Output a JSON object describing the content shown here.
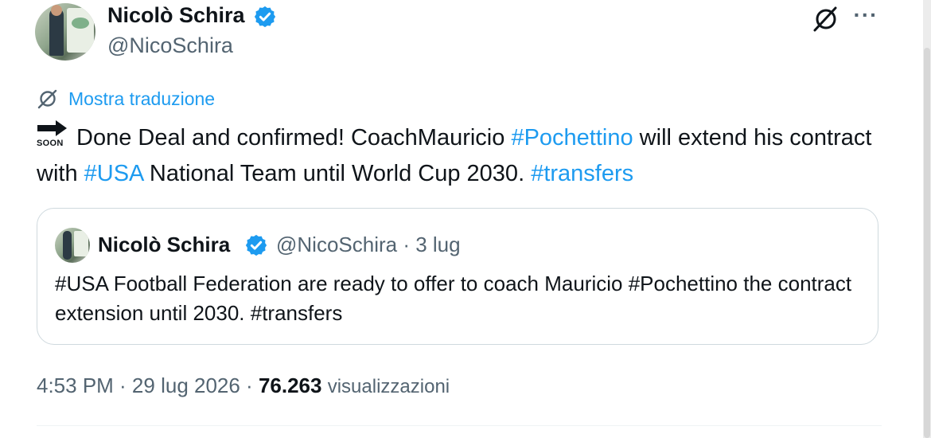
{
  "author": {
    "name": "Nicolò Schira",
    "handle": "@NicoSchira"
  },
  "translate": {
    "label": "Mostra traduzione"
  },
  "tweet": {
    "emoji": "soon-arrow-icon",
    "emoji_label": "SOON",
    "segments": [
      {
        "text": "Done Deal and confirmed! CoachMauricio ",
        "type": "text"
      },
      {
        "text": "#Pochettino",
        "type": "hashtag"
      },
      {
        "text": " will extend his contract with ",
        "type": "text"
      },
      {
        "text": "#USA",
        "type": "hashtag"
      },
      {
        "text": " National Team until World Cup 2030. ",
        "type": "text"
      },
      {
        "text": "#transfers",
        "type": "hashtag"
      }
    ]
  },
  "quote": {
    "name": "Nicolò Schira",
    "handle_date": "@NicoSchira · 3 lug",
    "text": "#USA Football Federation are ready to offer to coach Mauricio #Pochettino the contract extension until 2030. #transfers"
  },
  "meta": {
    "time_date": "4:53 PM · 29 lug 2026 · ",
    "views_count": "76.263",
    "views_label": "visualizzazioni"
  },
  "colors": {
    "accent": "#1d9bf0",
    "text": "#0f1419",
    "secondary": "#536471",
    "border": "#cfd9de"
  }
}
